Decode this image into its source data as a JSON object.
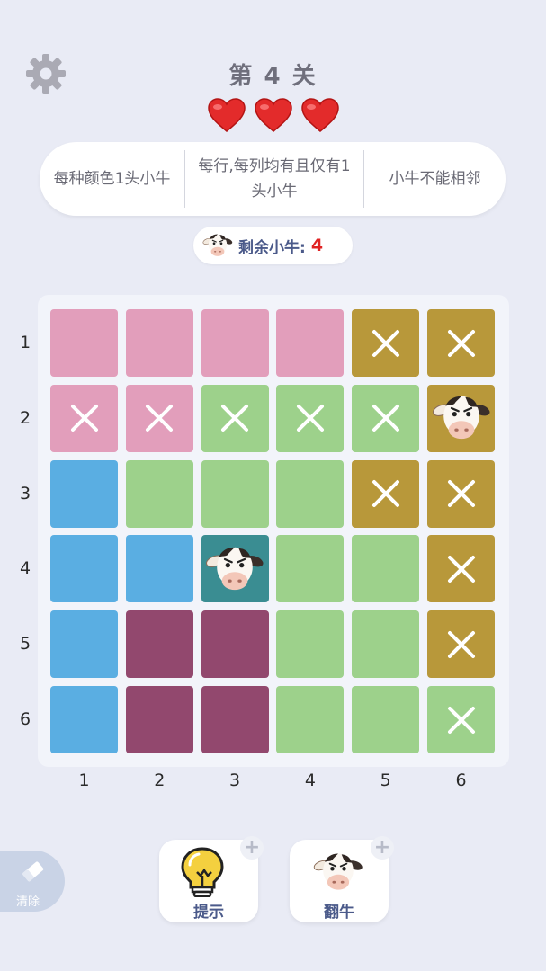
{
  "header": {
    "level_title": "第 4 关",
    "lives": 3
  },
  "rules": [
    {
      "text": "每种颜色1头小牛"
    },
    {
      "text": "每行,每列均有且仅有1头小牛"
    },
    {
      "text": "小牛不能相邻"
    }
  ],
  "remaining": {
    "label": "剩余小牛:",
    "count": "4"
  },
  "colors": {
    "pink": "#e29ebb",
    "gold": "#b8983a",
    "green": "#9dd18b",
    "blue": "#5aaee2",
    "purple": "#92486e",
    "teal": "#3a8d92"
  },
  "board": {
    "row_labels": [
      "1",
      "2",
      "3",
      "4",
      "5",
      "6"
    ],
    "col_labels": [
      "1",
      "2",
      "3",
      "4",
      "5",
      "6"
    ],
    "cells": [
      [
        {
          "color": "pink",
          "mark": ""
        },
        {
          "color": "pink",
          "mark": ""
        },
        {
          "color": "pink",
          "mark": ""
        },
        {
          "color": "pink",
          "mark": ""
        },
        {
          "color": "gold",
          "mark": "x"
        },
        {
          "color": "gold",
          "mark": "x"
        }
      ],
      [
        {
          "color": "pink",
          "mark": "x"
        },
        {
          "color": "pink",
          "mark": "x"
        },
        {
          "color": "green",
          "mark": "x"
        },
        {
          "color": "green",
          "mark": "x"
        },
        {
          "color": "green",
          "mark": "x"
        },
        {
          "color": "gold",
          "mark": "cow"
        }
      ],
      [
        {
          "color": "blue",
          "mark": ""
        },
        {
          "color": "green",
          "mark": ""
        },
        {
          "color": "green",
          "mark": ""
        },
        {
          "color": "green",
          "mark": ""
        },
        {
          "color": "gold",
          "mark": "x"
        },
        {
          "color": "gold",
          "mark": "x"
        }
      ],
      [
        {
          "color": "blue",
          "mark": ""
        },
        {
          "color": "blue",
          "mark": ""
        },
        {
          "color": "teal",
          "mark": "cow"
        },
        {
          "color": "green",
          "mark": ""
        },
        {
          "color": "green",
          "mark": ""
        },
        {
          "color": "gold",
          "mark": "x"
        }
      ],
      [
        {
          "color": "blue",
          "mark": ""
        },
        {
          "color": "purple",
          "mark": ""
        },
        {
          "color": "purple",
          "mark": ""
        },
        {
          "color": "green",
          "mark": ""
        },
        {
          "color": "green",
          "mark": ""
        },
        {
          "color": "gold",
          "mark": "x"
        }
      ],
      [
        {
          "color": "blue",
          "mark": ""
        },
        {
          "color": "purple",
          "mark": ""
        },
        {
          "color": "purple",
          "mark": ""
        },
        {
          "color": "green",
          "mark": ""
        },
        {
          "color": "green",
          "mark": ""
        },
        {
          "color": "green",
          "mark": "x"
        }
      ]
    ]
  },
  "toolbar": {
    "clear_label": "清除",
    "hint_label": "提示",
    "flip_label": "翻牛",
    "plus_symbol": "+"
  },
  "icons": {
    "settings": "gear-icon",
    "life": "heart-icon",
    "cow": "cow-icon",
    "hint": "lightbulb-icon",
    "clear": "eraser-icon"
  }
}
